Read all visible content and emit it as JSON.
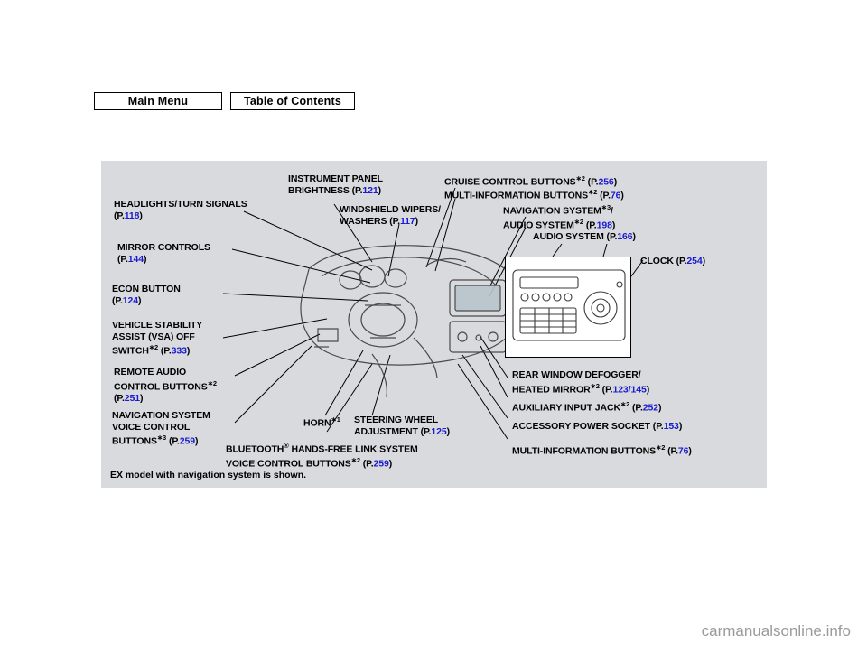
{
  "nav": {
    "main_menu": "Main Menu",
    "table_of_contents": "Table of Contents"
  },
  "panel": {
    "footnote": "EX model with navigation system is shown.",
    "labels": [
      {
        "id": "headlights-turn-signals",
        "line1": "HEADLIGHTS/TURN SIGNALS",
        "line2_prefix": "(P.",
        "page": "118",
        "line2_suffix": ")"
      },
      {
        "id": "mirror-controls",
        "line1": "MIRROR CONTROLS",
        "line2_prefix": "(P.",
        "page": "144",
        "line2_suffix": ")"
      },
      {
        "id": "econ-button",
        "line1": "ECON BUTTON",
        "line2_prefix": "(P.",
        "page": "124",
        "line2_suffix": ")"
      },
      {
        "id": "vehicle-stability-assist",
        "line1": "VEHICLE STABILITY",
        "line2": "ASSIST (VSA) OFF",
        "line3_prefix": "SWITCH",
        "line3_sup": "∗2",
        "line3_mid": " (P.",
        "page": "333",
        "line3_suffix": ")"
      },
      {
        "id": "remote-audio-control-buttons",
        "line1": "REMOTE AUDIO",
        "line2": "CONTROL BUTTONS",
        "line2_sup": "∗2",
        "line3_prefix": "(P.",
        "page": "251",
        "line3_suffix": ")"
      },
      {
        "id": "navigation-system-voice-control-buttons",
        "line1": "NAVIGATION SYSTEM",
        "line2": "VOICE CONTROL",
        "line3_prefix": "BUTTONS",
        "line3_sup": "∗3",
        "line3_mid": " (P.",
        "page": "259",
        "line3_suffix": ")"
      },
      {
        "id": "instrument-panel-brightness",
        "line1": "INSTRUMENT PANEL",
        "line2_prefix": "BRIGHTNESS (P.",
        "page": "121",
        "line2_suffix": ")"
      },
      {
        "id": "windshield-wipers-washers",
        "line1": "WINDSHIELD WIPERS/",
        "line2_prefix": "WASHERS (P.",
        "page": "117",
        "line2_suffix": ")"
      },
      {
        "id": "cruise-control-buttons",
        "line1_prefix": "CRUISE CONTROL BUTTONS",
        "line1_sup": "∗2",
        "line1_mid": " (P.",
        "page": "256",
        "line1_suffix": ")"
      },
      {
        "id": "multi-information-buttons-top",
        "line1_prefix": "MULTI-INFORMATION BUTTONS",
        "line1_sup": "∗2",
        "line1_mid": " (P.",
        "page": "76",
        "line1_suffix": ")"
      },
      {
        "id": "navigation-system-audio-system",
        "line1_prefix": "NAVIGATION SYSTEM",
        "line1_sup": "∗3",
        "line1_suffix": "/",
        "line2_prefix": "AUDIO SYSTEM",
        "line2_sup": "∗2",
        "line2_mid": " (P.",
        "page": "198",
        "line2_suffix": ")"
      },
      {
        "id": "audio-system",
        "line1_prefix": "AUDIO SYSTEM (P.",
        "page": "166",
        "line1_suffix": ")"
      },
      {
        "id": "clock",
        "line1_prefix": "CLOCK (P.",
        "page": "254",
        "line1_suffix": ")"
      },
      {
        "id": "rear-window-defogger-heated-mirror",
        "line1": "REAR WINDOW DEFOGGER/",
        "line2_prefix": "HEATED MIRROR",
        "line2_sup": "∗2",
        "line2_mid": " (P.",
        "page": "123/145",
        "line2_suffix": ")"
      },
      {
        "id": "auxiliary-input-jack",
        "line1_prefix": "AUXILIARY INPUT JACK",
        "line1_sup": "∗2",
        "line1_mid": " (P.",
        "page": "252",
        "line1_suffix": ")"
      },
      {
        "id": "accessory-power-socket",
        "line1_prefix": "ACCESSORY POWER SOCKET (P.",
        "page": "153",
        "line1_suffix": ")"
      },
      {
        "id": "multi-information-buttons-bottom",
        "line1_prefix": "MULTI-INFORMATION BUTTONS",
        "line1_sup": "∗2",
        "line1_mid": " (P.",
        "page": "76",
        "line1_suffix": ")"
      },
      {
        "id": "horn",
        "line1_prefix": "HORN",
        "line1_sup": "∗1"
      },
      {
        "id": "steering-wheel-adjustment",
        "line1": "STEERING WHEEL",
        "line2_prefix": "ADJUSTMENT (P.",
        "page": "125",
        "line2_suffix": ")"
      },
      {
        "id": "bluetooth-handsfree-link",
        "line1_prefix": "BLUETOOTH",
        "line1_sup": "®",
        "line1_suffix": " HANDS-FREE LINK SYSTEM",
        "line2_prefix": "VOICE CONTROL BUTTONS",
        "line2_sup": "∗2",
        "line2_mid": " (P.",
        "page": "259",
        "line2_suffix": ")"
      }
    ]
  },
  "watermark": "carmanualsonline.info",
  "colors": {
    "page_link": "#1a1ad0",
    "panel_background": "#d9dade",
    "page_background": "#ffffff"
  }
}
